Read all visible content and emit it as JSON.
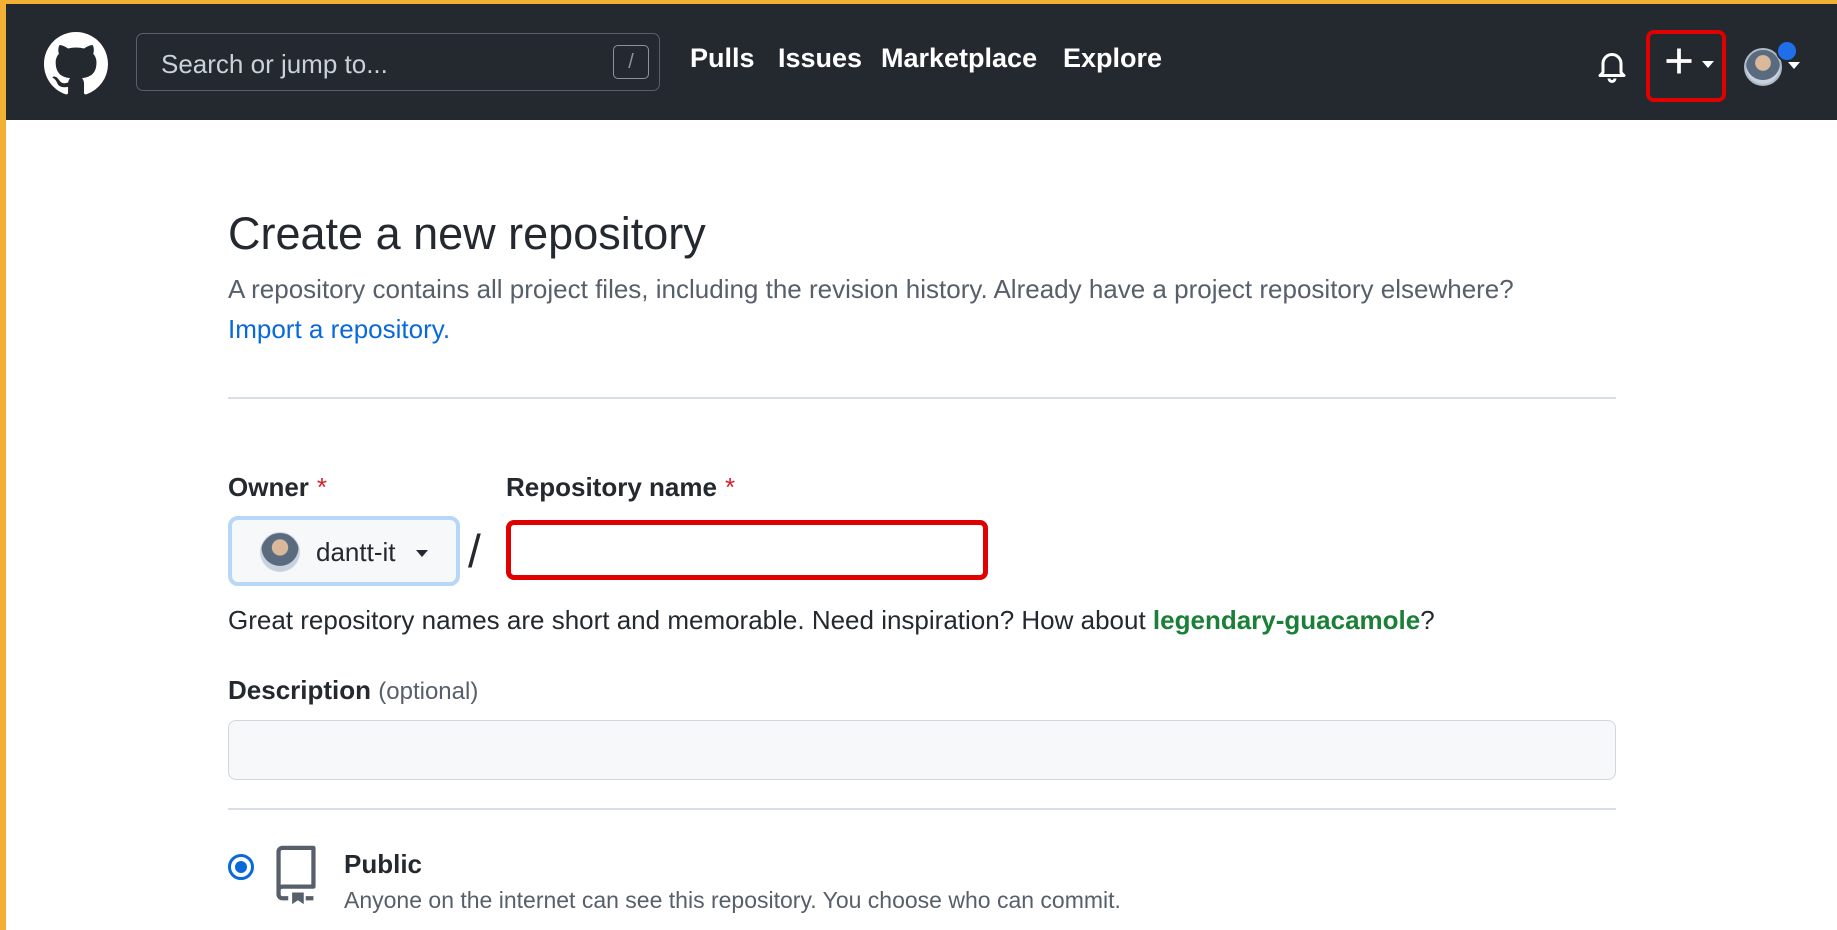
{
  "colors": {
    "header_bg": "#24292f",
    "frame_accent": "#f2b134",
    "highlight_red": "#e00000",
    "link_blue": "#0969da",
    "suggestion_green": "#1a7f37",
    "required_red": "#cf222e"
  },
  "header": {
    "logo_icon": "github-octocat-icon",
    "search": {
      "placeholder": "Search or jump to...",
      "shortcut": "/"
    },
    "nav": [
      "Pulls",
      "Issues",
      "Marketplace",
      "Explore"
    ],
    "icons": [
      "bell-icon",
      "plus-icon",
      "avatar"
    ]
  },
  "page": {
    "title": "Create a new repository",
    "subtitle": "A repository contains all project files, including the revision history. Already have a project repository elsewhere?",
    "import_link": "Import a repository."
  },
  "form": {
    "owner_label": "Owner",
    "repo_name_label": "Repository name",
    "required_mark": "*",
    "owner_value": "dantt-it",
    "separator": "/",
    "repo_name_value": "",
    "hint_prefix": "Great repository names are short and memorable. Need inspiration? How about ",
    "hint_suggestion": "legendary-guacamole",
    "hint_suffix": "?",
    "description_label": "Description",
    "description_optional": "(optional)",
    "description_value": "",
    "visibility": {
      "label": "Public",
      "description": "Anyone on the internet can see this repository. You choose who can commit.",
      "selected": true
    }
  }
}
